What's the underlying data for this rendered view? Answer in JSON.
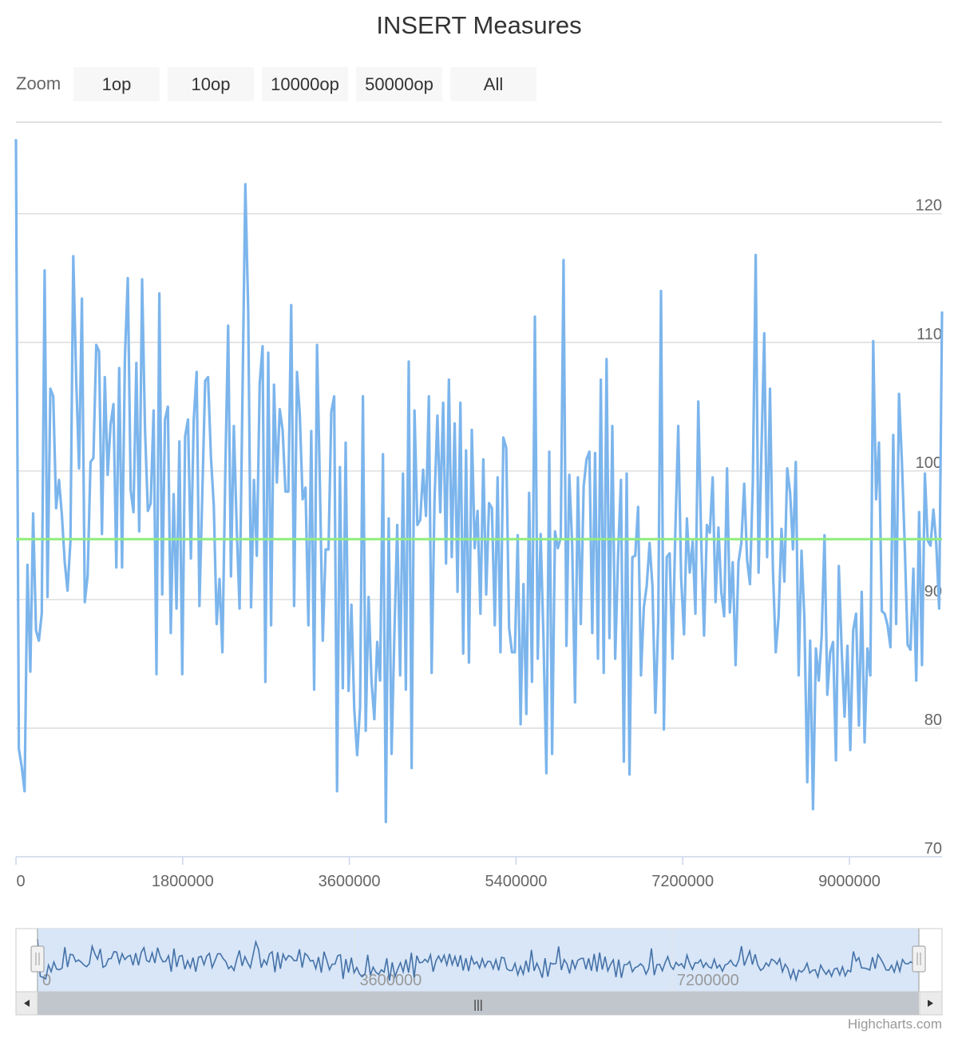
{
  "title": "INSERT Measures",
  "zoom": {
    "label": "Zoom",
    "buttons": [
      "1op",
      "10op",
      "10000op",
      "50000op",
      "All"
    ]
  },
  "credits": "Highcharts.com",
  "navigator": {
    "x_labels": [
      "0",
      "3600000",
      "7200000"
    ],
    "handle_glyph": "|||"
  },
  "colors": {
    "series": "#7cb5ec",
    "average": "#90ed7d",
    "navigator_fill": "#d8e6f8",
    "navigator_line": "#4572a7",
    "scrollbar": "#c1c6cc"
  },
  "chart_data": {
    "type": "line",
    "title": "INSERT Measures",
    "xlabel": "",
    "ylabel": "",
    "xlim": [
      0,
      10000000
    ],
    "ylim": [
      70,
      127
    ],
    "x_ticks": [
      0,
      1800000,
      3600000,
      5400000,
      7200000,
      9000000
    ],
    "y_ticks": [
      70,
      80,
      90,
      100,
      110,
      120
    ],
    "y_axis_side": "right",
    "grid": true,
    "legend": "none",
    "series": [
      {
        "values": [
          125.8,
          78.4,
          77,
          75.1,
          92.7,
          84.4,
          96.7,
          87.6,
          86.8,
          88.9,
          115.6,
          90.2,
          106.4,
          105.8,
          97.1,
          99.3,
          96.6,
          92.9,
          90.7,
          94.5,
          116.7,
          107.2,
          100.2,
          113.4,
          89.8,
          91.9,
          100.7,
          101,
          109.8,
          109.3,
          95.1,
          107.3,
          99.7,
          103.6,
          105.2,
          92.5,
          108,
          92.5,
          108.9,
          115,
          98.5,
          96.8,
          108.4,
          95.3,
          114.9,
          103.3,
          96.9,
          97.5,
          104.7,
          84.2,
          113.8,
          90.4,
          104,
          105,
          87.4,
          98.2,
          89.3,
          102.3,
          84.2,
          102.7,
          104,
          93.2,
          104,
          107.7,
          89.5,
          98.2,
          107,
          107.3,
          101.1,
          97.3,
          88.1,
          91.6,
          85.9,
          99.9,
          111.3,
          91.8,
          103.5,
          95.6,
          89.3,
          105.7,
          122.3,
          112.5,
          89.4,
          99.3,
          93.4,
          106.8,
          109.7,
          83.6,
          109.2,
          88,
          106.7,
          99.1,
          104.8,
          103.2,
          98.4,
          98.4,
          112.9,
          89.5,
          107.7,
          104.4,
          97.8,
          98.7,
          88,
          103.1,
          83,
          109.8,
          99,
          86.8,
          93.9,
          93.9,
          104.6,
          105.8,
          75.1,
          100.3,
          83.1,
          102.2,
          82.9,
          89.6,
          81.4,
          77.9,
          81.6,
          105.8,
          79.8,
          90.2,
          83.7,
          80.7,
          86.7,
          83.7,
          101.3,
          72.7,
          96.3,
          78,
          87.5,
          95.8,
          84.1,
          99.8,
          83,
          108.5,
          76.9,
          104.7,
          95.8,
          96.2,
          100.1,
          96.5,
          105.8,
          84.3,
          97.8,
          104.3,
          96.8,
          105.3,
          92.8,
          107.1,
          93.3,
          103.7,
          90.6,
          105.3,
          85.8,
          101.6,
          85.1,
          103.2,
          94,
          96.9,
          88.9,
          100.9,
          90.4,
          97.5,
          97.1,
          88,
          99.5,
          85.9,
          102.6,
          101.8,
          87.8,
          85.9,
          85.9,
          95,
          80.3,
          91.2,
          81.1,
          98.3,
          83.6,
          112,
          85.4,
          95.1,
          86.9,
          76.5,
          101.5,
          78,
          95.3,
          94,
          94.8,
          116.4,
          86.4,
          99.7,
          94.3,
          82,
          99.5,
          88.1,
          98.8,
          100.9,
          101.5,
          87.4,
          101.4,
          85.4,
          107.1,
          84.3,
          108.7,
          87,
          103.5,
          85.4,
          93.4,
          99.3,
          77.4,
          99.8,
          76.4,
          93.3,
          93.4,
          97.2,
          84.1,
          89.4,
          91.1,
          94.4,
          91,
          81.2,
          88.3,
          114,
          79.9,
          93.3,
          93.6,
          85.4,
          95.5,
          103.5,
          91.7,
          87.3,
          96.3,
          92.1,
          94.5,
          88.9,
          105.4,
          94.7,
          87.2,
          95.8,
          95.2,
          99.5,
          89.8,
          95.6,
          90.6,
          88.7,
          100.2,
          89,
          92.9,
          84.9,
          92.9,
          94.4,
          99,
          93.1,
          91.2,
          99.1,
          116.8,
          92.1,
          101.3,
          110.7,
          93.3,
          106.4,
          92.5,
          85.9,
          88.7,
          95.5,
          91.4,
          100.2,
          98.3,
          93.9,
          100.7,
          84.1,
          93.8,
          88.5,
          75.8,
          86.8,
          73.7,
          86.2,
          83.7,
          87.1,
          95,
          82.6,
          85.9,
          86.7,
          77.5,
          92.6,
          86.1,
          80.9,
          86.4,
          78.3,
          87.6,
          88.9,
          80.2,
          90.6,
          78.9,
          86.2,
          84.1,
          110.1,
          97.8,
          102.2,
          89.1,
          88.9,
          88,
          86.3,
          102.8,
          88.1,
          106,
          100.8,
          94.2,
          86.5,
          86.1,
          92.4,
          83.7,
          96.8,
          84.9,
          99.8,
          94.6,
          94.2,
          97,
          94.3,
          89.3,
          112.4
        ]
      },
      {
        "values": [
          94.7,
          94.7
        ]
      }
    ]
  }
}
